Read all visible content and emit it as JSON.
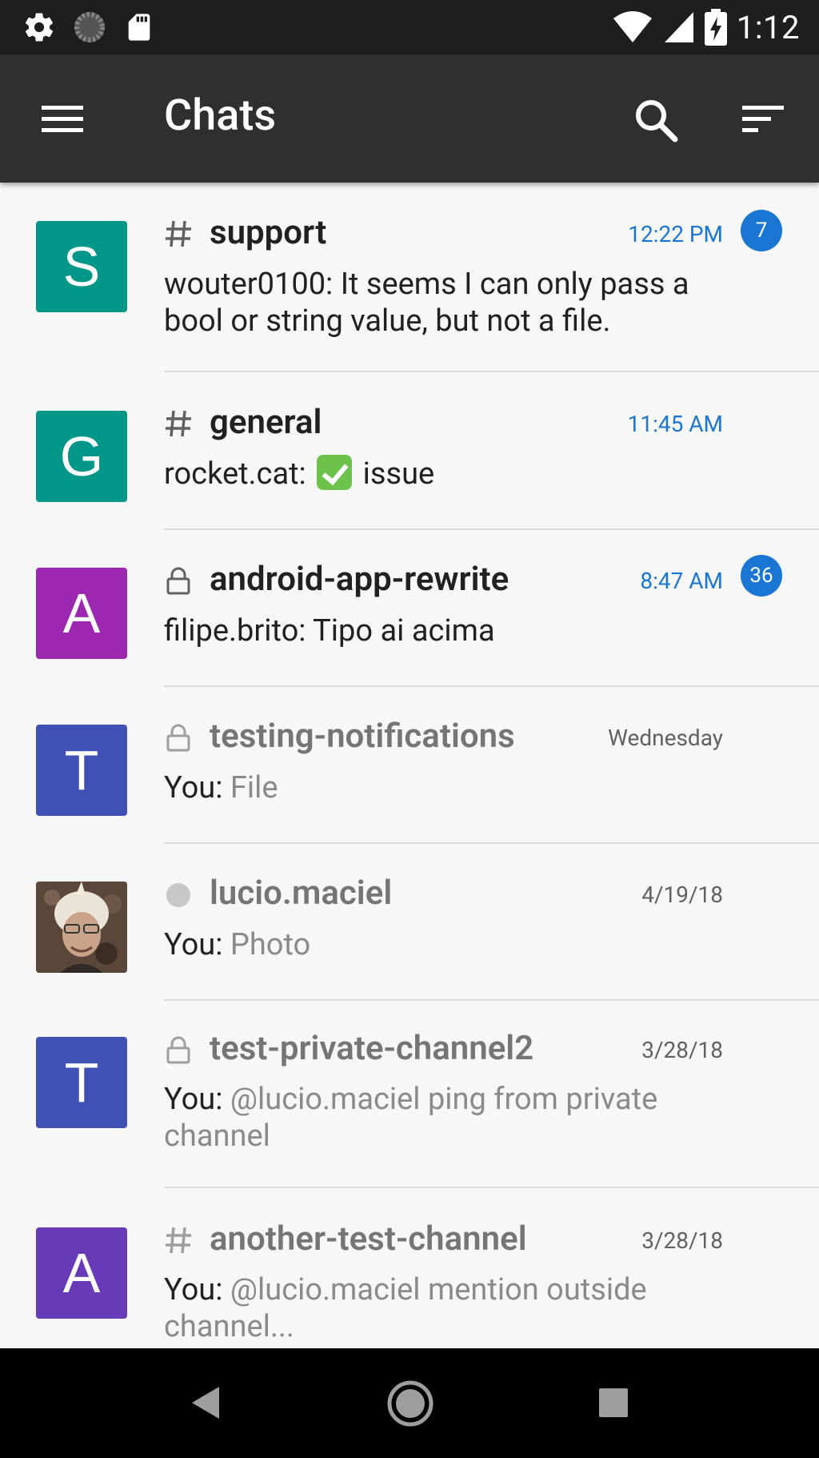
{
  "status_bar": {
    "time": "1:12",
    "icons": [
      "gear-icon",
      "loading-icon",
      "sd-card-icon",
      "wifi-icon",
      "cell-signal-icon",
      "battery-charging-icon"
    ]
  },
  "toolbar": {
    "title": "Chats",
    "icons": [
      "menu-icon",
      "search-icon",
      "sort-icon"
    ]
  },
  "chats": [
    {
      "avatar_letter": "S",
      "avatar_color": "#009688",
      "room_icon": "hash-icon",
      "name": "support",
      "time": "12:22 PM",
      "badge": "7",
      "author": "wouter0100:",
      "message": " It seems I can only pass a bool or string value, but not a file.",
      "unread": true
    },
    {
      "avatar_letter": "G",
      "avatar_color": "#009688",
      "room_icon": "hash-icon",
      "name": "general",
      "time": "11:45 AM",
      "badge": "",
      "author": "rocket.cat:",
      "message": "issue",
      "emoji": "check-mark-emoji",
      "unread": true
    },
    {
      "avatar_letter": "A",
      "avatar_color": "#9c27b0",
      "room_icon": "lock-icon",
      "name": "android-app-rewrite",
      "time": "8:47 AM",
      "badge": "36",
      "author": "filipe.brito:",
      "message": " Tipo ai acima",
      "unread": true
    },
    {
      "avatar_letter": "T",
      "avatar_color": "#3f51b5",
      "room_icon": "lock-icon",
      "name": "testing-notifications",
      "time": "Wednesday",
      "badge": "",
      "author": "You:",
      "message": " File",
      "unread": false
    },
    {
      "avatar_letter": "",
      "avatar_color": "#5a4638",
      "room_icon": "presence-offline-icon",
      "name": "lucio.maciel",
      "time": "4/19/18",
      "badge": "",
      "author": "You:",
      "message": " Photo",
      "unread": false
    },
    {
      "avatar_letter": "T",
      "avatar_color": "#3f51b5",
      "room_icon": "lock-icon",
      "name": "test-private-channel2",
      "time": "3/28/18",
      "badge": "",
      "author": "You:",
      "message": " @lucio.maciel ping from private channel",
      "unread": false
    },
    {
      "avatar_letter": "A",
      "avatar_color": "#673ab7",
      "room_icon": "hash-icon",
      "name": "another-test-channel",
      "time": "3/28/18",
      "badge": "",
      "author": "You:",
      "message": " @lucio.maciel mention outside channel...",
      "unread": false
    }
  ],
  "nav_bar": {
    "icons": [
      "back-icon",
      "home-icon",
      "recents-icon"
    ]
  }
}
